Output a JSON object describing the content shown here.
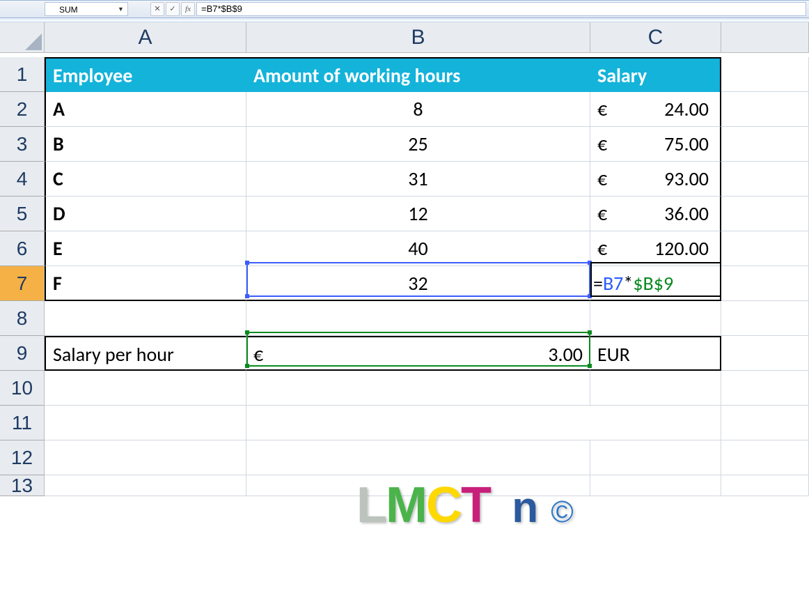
{
  "formula_bar": {
    "name_box": "SUM",
    "cancel": "✕",
    "enter": "✓",
    "fx": "fx",
    "formula": "=B7*$B$9"
  },
  "columns": [
    "A",
    "B",
    "C"
  ],
  "rows": [
    "1",
    "2",
    "3",
    "4",
    "5",
    "6",
    "7",
    "8",
    "9",
    "10",
    "11",
    "12",
    "13"
  ],
  "active_row": "7",
  "active_cell": "C7",
  "headers": {
    "A": "Employee",
    "B": "Amount of working hours",
    "C": "Salary"
  },
  "data": [
    {
      "emp": "A",
      "hours": "8",
      "salary": "24.00"
    },
    {
      "emp": "B",
      "hours": "25",
      "salary": "75.00"
    },
    {
      "emp": "C",
      "hours": "31",
      "salary": "93.00"
    },
    {
      "emp": "D",
      "hours": "12",
      "salary": "36.00"
    },
    {
      "emp": "E",
      "hours": "40",
      "salary": "120.00"
    },
    {
      "emp": "F",
      "hours": "32",
      "salary_formula": {
        "eq": "=",
        "ref1": "B7",
        "op": "*",
        "ref2": "$B$9"
      }
    }
  ],
  "currency": "€",
  "rate_row": {
    "label": "Salary per hour",
    "value": "3.00",
    "unit": "EUR"
  },
  "watermark": {
    "L": "L",
    "M": "M",
    "C": "C",
    "T": "T",
    "n": " n",
    "copy": " ©"
  }
}
